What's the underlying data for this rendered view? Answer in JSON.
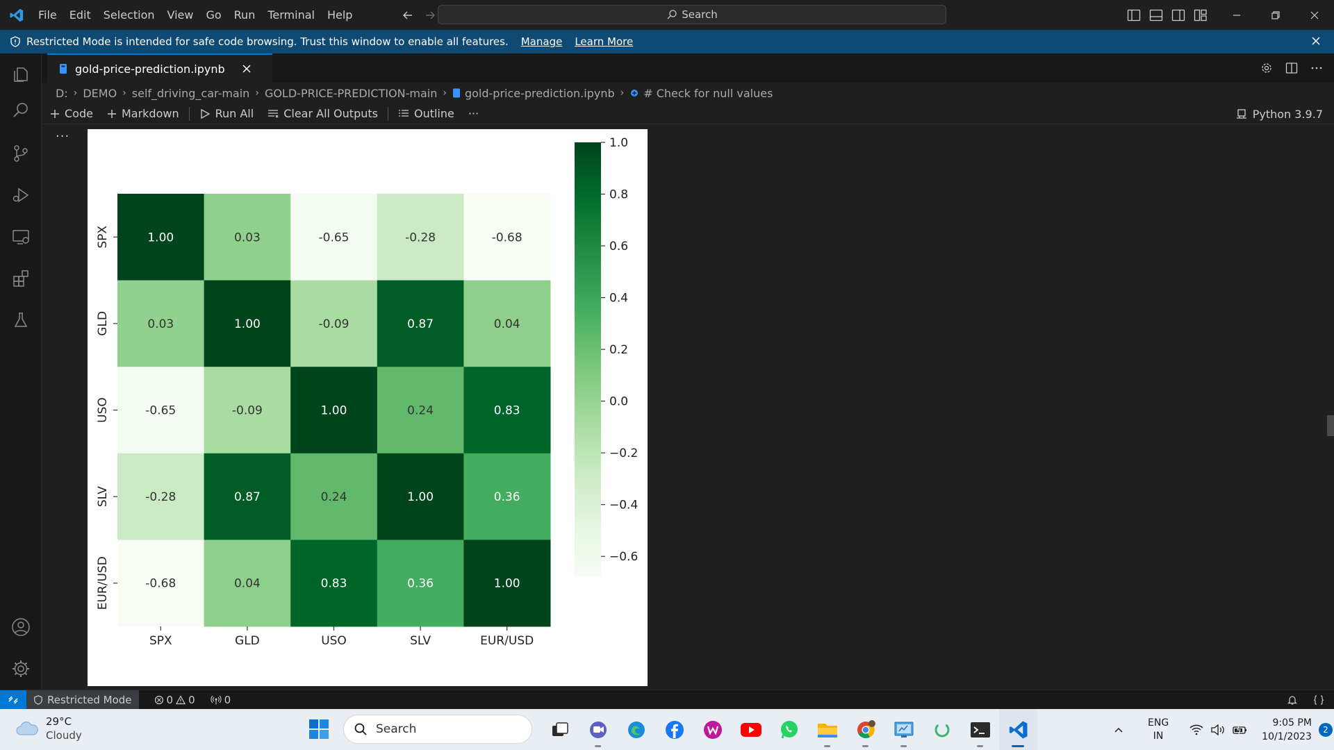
{
  "titlebar": {
    "menu": [
      "File",
      "Edit",
      "Selection",
      "View",
      "Go",
      "Run",
      "Terminal",
      "Help"
    ],
    "search_label": "Search"
  },
  "banner": {
    "message": "Restricted Mode is intended for safe code browsing. Trust this window to enable all features.",
    "manage": "Manage",
    "learn_more": "Learn More"
  },
  "tab": {
    "label": "gold-price-prediction.ipynb"
  },
  "breadcrumbs": [
    "D:",
    "DEMO",
    "self_driving_car-main",
    "GOLD-PRICE-PREDICTION-main",
    "gold-price-prediction.ipynb",
    "# Check for null values"
  ],
  "nb_toolbar": {
    "code": "Code",
    "markdown": "Markdown",
    "run_all": "Run All",
    "clear_outputs": "Clear All Outputs",
    "outline": "Outline",
    "more": "···",
    "kernel": "Python 3.9.7"
  },
  "cell": {
    "more": "···"
  },
  "chart_data": {
    "type": "heatmap",
    "colormap": "Greens",
    "x_labels": [
      "SPX",
      "GLD",
      "USO",
      "SLV",
      "EUR/USD"
    ],
    "y_labels": [
      "SPX",
      "GLD",
      "USO",
      "SLV",
      "EUR/USD"
    ],
    "values": [
      [
        1.0,
        0.03,
        -0.65,
        -0.28,
        -0.68
      ],
      [
        0.03,
        1.0,
        -0.09,
        0.87,
        0.04
      ],
      [
        -0.65,
        -0.09,
        1.0,
        0.24,
        0.83
      ],
      [
        -0.28,
        0.87,
        0.24,
        1.0,
        0.36
      ],
      [
        -0.68,
        0.04,
        0.83,
        0.36,
        1.0
      ]
    ],
    "annotations": [
      [
        "1.00",
        "0.03",
        "-0.65",
        "-0.28",
        "-0.68"
      ],
      [
        "0.03",
        "1.00",
        "-0.09",
        "0.87",
        "0.04"
      ],
      [
        "-0.65",
        "-0.09",
        "1.00",
        "0.24",
        "0.83"
      ],
      [
        "-0.28",
        "0.87",
        "0.24",
        "1.00",
        "0.36"
      ],
      [
        "-0.68",
        "0.04",
        "0.83",
        "0.36",
        "1.00"
      ]
    ],
    "colorbar_range": [
      -0.68,
      1.0
    ],
    "colorbar_ticks": [
      1.0,
      0.8,
      0.6,
      0.4,
      0.2,
      0.0,
      -0.2,
      -0.4,
      -0.6
    ],
    "colorbar_tick_labels": [
      "1.0",
      "0.8",
      "0.6",
      "0.4",
      "0.2",
      "0.0",
      "−0.2",
      "−0.4",
      "−0.6"
    ]
  },
  "statusbar": {
    "restricted": "Restricted Mode",
    "errors": "0",
    "warnings": "0",
    "ports": "0"
  },
  "taskbar": {
    "temperature": "29°C",
    "condition": "Cloudy",
    "search": "Search",
    "lang_line1": "ENG",
    "lang_line2": "IN",
    "time": "9:05 PM",
    "date": "10/1/2023",
    "notifications": "2"
  },
  "colors": {
    "accent": "#0078d4",
    "banner_bg": "#0e4a73",
    "editor_bg": "#1f1f1f",
    "heat_low": "#f7fcf5",
    "heat_high": "#00441b"
  }
}
